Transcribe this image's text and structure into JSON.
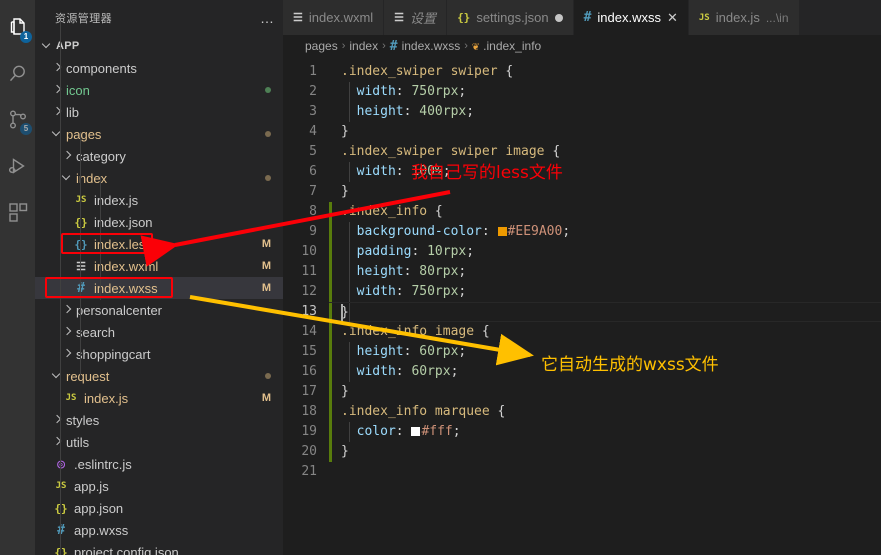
{
  "activity_bar": {
    "items": [
      {
        "name": "explorer",
        "icon": "files-icon",
        "badge": "1",
        "active": true
      },
      {
        "name": "search",
        "icon": "search-icon",
        "badge": "",
        "active": false
      },
      {
        "name": "source-control",
        "icon": "source-control-icon",
        "badge": "5",
        "active": false
      },
      {
        "name": "run-debug",
        "icon": "run-debug-icon",
        "badge": "",
        "active": false
      },
      {
        "name": "extensions",
        "icon": "extensions-icon",
        "badge": "",
        "active": false
      }
    ]
  },
  "sidebar": {
    "title": "资源管理器",
    "more_actions": "…",
    "root": {
      "label": "APP",
      "expanded": true
    },
    "tree": [
      {
        "label": "components",
        "type": "folder",
        "indent": 1,
        "expanded": false,
        "icon": "chevron-right-icon",
        "status": "",
        "dot": ""
      },
      {
        "label": "icon",
        "type": "folder",
        "indent": 1,
        "expanded": false,
        "icon": "chevron-right-icon",
        "status": "",
        "dot": "green",
        "color": "untracked"
      },
      {
        "label": "lib",
        "type": "folder",
        "indent": 1,
        "expanded": false,
        "icon": "chevron-right-icon",
        "status": "",
        "dot": ""
      },
      {
        "label": "pages",
        "type": "folder",
        "indent": 1,
        "expanded": true,
        "icon": "chevron-down-icon",
        "status": "",
        "dot": "tan",
        "color": "mod"
      },
      {
        "label": "category",
        "type": "folder",
        "indent": 2,
        "expanded": false,
        "icon": "chevron-right-icon",
        "status": "",
        "dot": ""
      },
      {
        "label": "index",
        "type": "folder",
        "indent": 2,
        "expanded": true,
        "icon": "chevron-down-icon",
        "status": "",
        "dot": "tan",
        "color": "mod"
      },
      {
        "label": "index.js",
        "type": "file",
        "indent": 3,
        "icon": "js",
        "status": "",
        "dot": ""
      },
      {
        "label": "index.json",
        "type": "file",
        "indent": 3,
        "icon": "json",
        "status": "",
        "dot": ""
      },
      {
        "label": "index.less",
        "type": "file",
        "indent": 3,
        "icon": "less",
        "status": "M",
        "color": "mod",
        "dot": ""
      },
      {
        "label": "index.wxml",
        "type": "file",
        "indent": 3,
        "icon": "wxml",
        "status": "M",
        "color": "mod",
        "dot": ""
      },
      {
        "label": "index.wxss",
        "type": "file",
        "indent": 3,
        "icon": "wxss",
        "status": "M",
        "color": "mod",
        "dot": "",
        "selected": true
      },
      {
        "label": "personalcenter",
        "type": "folder",
        "indent": 2,
        "expanded": false,
        "icon": "chevron-right-icon",
        "status": "",
        "dot": ""
      },
      {
        "label": "search",
        "type": "folder",
        "indent": 2,
        "expanded": false,
        "icon": "chevron-right-icon",
        "status": "",
        "dot": ""
      },
      {
        "label": "shoppingcart",
        "type": "folder",
        "indent": 2,
        "expanded": false,
        "icon": "chevron-right-icon",
        "status": "",
        "dot": ""
      },
      {
        "label": "request",
        "type": "folder",
        "indent": 1,
        "expanded": true,
        "icon": "chevron-down-icon",
        "status": "",
        "dot": "tan",
        "color": "mod"
      },
      {
        "label": "index.js",
        "type": "file",
        "indent": 2,
        "icon": "js",
        "status": "M",
        "color": "mod",
        "dot": ""
      },
      {
        "label": "styles",
        "type": "folder",
        "indent": 1,
        "expanded": false,
        "icon": "chevron-right-icon",
        "status": "",
        "dot": ""
      },
      {
        "label": "utils",
        "type": "folder",
        "indent": 1,
        "expanded": false,
        "icon": "chevron-right-icon",
        "status": "",
        "dot": ""
      },
      {
        "label": ".eslintrc.js",
        "type": "file",
        "indent": 1,
        "icon": "eslint",
        "status": "",
        "dot": ""
      },
      {
        "label": "app.js",
        "type": "file",
        "indent": 1,
        "icon": "js",
        "status": "",
        "dot": ""
      },
      {
        "label": "app.json",
        "type": "file",
        "indent": 1,
        "icon": "json",
        "status": "",
        "dot": ""
      },
      {
        "label": "app.wxss",
        "type": "file",
        "indent": 1,
        "icon": "wxss",
        "status": "",
        "dot": ""
      },
      {
        "label": "project.config.json",
        "type": "file",
        "indent": 1,
        "icon": "json",
        "status": "",
        "dot": ""
      }
    ]
  },
  "tabs": [
    {
      "label": "index.wxml",
      "icon": "wxml",
      "active": false,
      "dirty": false,
      "closable": false,
      "italic": false,
      "suffix": ""
    },
    {
      "label": "设置",
      "icon": "settings",
      "active": false,
      "dirty": false,
      "closable": false,
      "italic": true,
      "suffix": ""
    },
    {
      "label": "settings.json",
      "icon": "json",
      "active": false,
      "dirty": true,
      "closable": false,
      "italic": false,
      "suffix": ""
    },
    {
      "label": "index.wxss",
      "icon": "wxss",
      "active": true,
      "dirty": false,
      "closable": true,
      "close_label": "✕",
      "italic": false,
      "suffix": ""
    },
    {
      "label": "index.js",
      "icon": "js",
      "active": false,
      "dirty": false,
      "closable": false,
      "italic": false,
      "suffix": "...\\in"
    }
  ],
  "breadcrumb": {
    "items": [
      "pages",
      "index",
      "index.wxss",
      ".index_info"
    ],
    "separator": "›",
    "file_icon": "#",
    "symbol_icon": "css-symbol-icon"
  },
  "editor": {
    "total_lines": 21,
    "current_line": 13,
    "git_added_from": 8,
    "git_added_to": 20,
    "lines": [
      {
        "n": 1,
        "tokens": [
          {
            "t": ".index_swiper swiper ",
            "c": "sel"
          },
          {
            "t": "{",
            "c": "punc"
          }
        ]
      },
      {
        "n": 2,
        "tokens": [
          {
            "t": "  ",
            "c": "punc"
          },
          {
            "t": "width",
            "c": "prop"
          },
          {
            "t": ": ",
            "c": "punc"
          },
          {
            "t": "750rpx",
            "c": "num"
          },
          {
            "t": ";",
            "c": "punc"
          }
        ]
      },
      {
        "n": 3,
        "tokens": [
          {
            "t": "  ",
            "c": "punc"
          },
          {
            "t": "height",
            "c": "prop"
          },
          {
            "t": ": ",
            "c": "punc"
          },
          {
            "t": "400rpx",
            "c": "num"
          },
          {
            "t": ";",
            "c": "punc"
          }
        ]
      },
      {
        "n": 4,
        "tokens": [
          {
            "t": "}",
            "c": "punc"
          }
        ]
      },
      {
        "n": 5,
        "tokens": [
          {
            "t": ".index_swiper swiper image ",
            "c": "sel"
          },
          {
            "t": "{",
            "c": "punc"
          }
        ]
      },
      {
        "n": 6,
        "tokens": [
          {
            "t": "  ",
            "c": "punc"
          },
          {
            "t": "width",
            "c": "prop"
          },
          {
            "t": ": ",
            "c": "punc"
          },
          {
            "t": "100%",
            "c": "num"
          },
          {
            "t": ";",
            "c": "punc"
          }
        ]
      },
      {
        "n": 7,
        "tokens": [
          {
            "t": "}",
            "c": "punc"
          }
        ]
      },
      {
        "n": 8,
        "tokens": [
          {
            "t": ".index_info ",
            "c": "sel"
          },
          {
            "t": "{",
            "c": "punc"
          }
        ]
      },
      {
        "n": 9,
        "tokens": [
          {
            "t": "  ",
            "c": "punc"
          },
          {
            "t": "background-color",
            "c": "prop"
          },
          {
            "t": ": ",
            "c": "punc"
          },
          {
            "t": "#EE9A00",
            "c": "hex",
            "swatch": "#EE9A00"
          },
          {
            "t": ";",
            "c": "punc"
          }
        ]
      },
      {
        "n": 10,
        "tokens": [
          {
            "t": "  ",
            "c": "punc"
          },
          {
            "t": "padding",
            "c": "prop"
          },
          {
            "t": ": ",
            "c": "punc"
          },
          {
            "t": "10rpx",
            "c": "num"
          },
          {
            "t": ";",
            "c": "punc"
          }
        ]
      },
      {
        "n": 11,
        "tokens": [
          {
            "t": "  ",
            "c": "punc"
          },
          {
            "t": "height",
            "c": "prop"
          },
          {
            "t": ": ",
            "c": "punc"
          },
          {
            "t": "80rpx",
            "c": "num"
          },
          {
            "t": ";",
            "c": "punc"
          }
        ]
      },
      {
        "n": 12,
        "tokens": [
          {
            "t": "  ",
            "c": "punc"
          },
          {
            "t": "width",
            "c": "prop"
          },
          {
            "t": ": ",
            "c": "punc"
          },
          {
            "t": "750rpx",
            "c": "num"
          },
          {
            "t": ";",
            "c": "punc"
          }
        ]
      },
      {
        "n": 13,
        "tokens": [
          {
            "t": "}",
            "c": "punc"
          }
        ]
      },
      {
        "n": 14,
        "tokens": [
          {
            "t": ".index_info image ",
            "c": "sel"
          },
          {
            "t": "{",
            "c": "punc"
          }
        ]
      },
      {
        "n": 15,
        "tokens": [
          {
            "t": "  ",
            "c": "punc"
          },
          {
            "t": "height",
            "c": "prop"
          },
          {
            "t": ": ",
            "c": "punc"
          },
          {
            "t": "60rpx",
            "c": "num"
          },
          {
            "t": ";",
            "c": "punc"
          }
        ]
      },
      {
        "n": 16,
        "tokens": [
          {
            "t": "  ",
            "c": "punc"
          },
          {
            "t": "width",
            "c": "prop"
          },
          {
            "t": ": ",
            "c": "punc"
          },
          {
            "t": "60rpx",
            "c": "num"
          },
          {
            "t": ";",
            "c": "punc"
          }
        ]
      },
      {
        "n": 17,
        "tokens": [
          {
            "t": "}",
            "c": "punc"
          }
        ]
      },
      {
        "n": 18,
        "tokens": [
          {
            "t": ".index_info marquee ",
            "c": "sel"
          },
          {
            "t": "{",
            "c": "punc"
          }
        ]
      },
      {
        "n": 19,
        "tokens": [
          {
            "t": "  ",
            "c": "punc"
          },
          {
            "t": "color",
            "c": "prop"
          },
          {
            "t": ": ",
            "c": "punc"
          },
          {
            "t": "#fff",
            "c": "hex",
            "swatch": "#ffffff"
          },
          {
            "t": ";",
            "c": "punc"
          }
        ]
      },
      {
        "n": 20,
        "tokens": [
          {
            "t": "}",
            "c": "punc"
          }
        ]
      },
      {
        "n": 21,
        "tokens": []
      }
    ]
  },
  "annotations": {
    "red_note": "我自己写的less文件",
    "yellow_note": "它自动生成的wxss文件",
    "red_color": "#fb0007",
    "yellow_color": "#ffc000"
  }
}
